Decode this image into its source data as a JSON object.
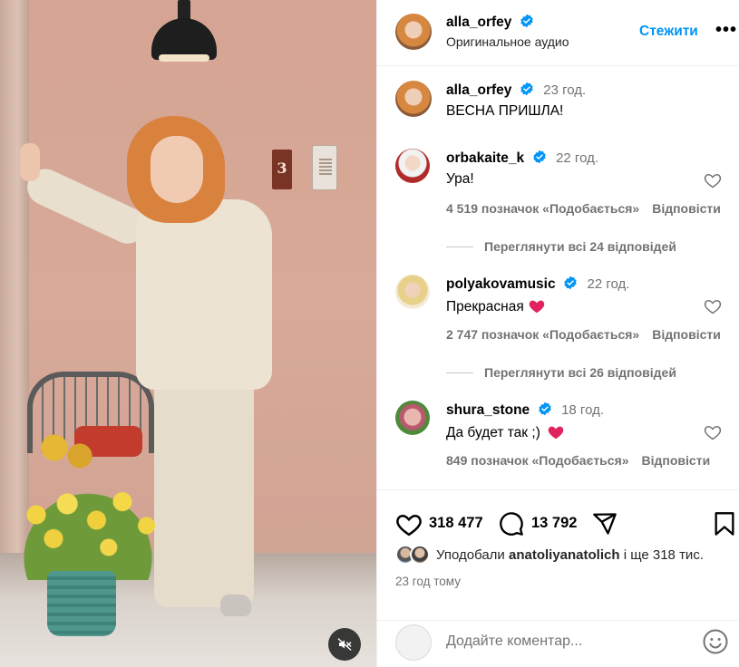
{
  "post": {
    "author": "alla_orfey",
    "audio": "Оригинальное аудио",
    "follow_label": "Стежити",
    "more_label": "•••",
    "caption_time": "23 год.",
    "caption": "ВЕСНА ПРИШЛА!",
    "house_number": "3"
  },
  "comments": [
    {
      "user": "orbakaite_k",
      "time": "22 год.",
      "text": "Ура!",
      "likes": "4 519 позначок «Подобається»",
      "reply": "Відповісти",
      "view_replies": "Переглянути всі 24 відповідей"
    },
    {
      "user": "polyakovamusic",
      "time": "22 год.",
      "text": "Прекрасная",
      "likes": "2 747 позначок «Подобається»",
      "reply": "Відповісти",
      "view_replies": "Переглянути всі 26 відповідей"
    },
    {
      "user": "shura_stone",
      "time": "18 год.",
      "text": "Да будет так ;)",
      "likes": "849 позначок «Подобається»",
      "reply": "Відповісти"
    }
  ],
  "stats": {
    "likes_count": "318 477",
    "comments_count": "13 792",
    "liked_by_prefix": "Уподобали",
    "liked_by_user": "anatoliyanatolich",
    "liked_by_suffix": "і ще 318 тис.",
    "posted_ago": "23 год тому"
  },
  "composer": {
    "placeholder": "Додайте коментар..."
  },
  "colors": {
    "accent": "#0095f6",
    "heart_red": "#e0245e",
    "muted_text": "#737373"
  },
  "icons": [
    "verified-icon",
    "more-icon",
    "heart-icon",
    "comment-icon",
    "share-icon",
    "bookmark-icon",
    "emoji-icon",
    "mute-icon"
  ]
}
